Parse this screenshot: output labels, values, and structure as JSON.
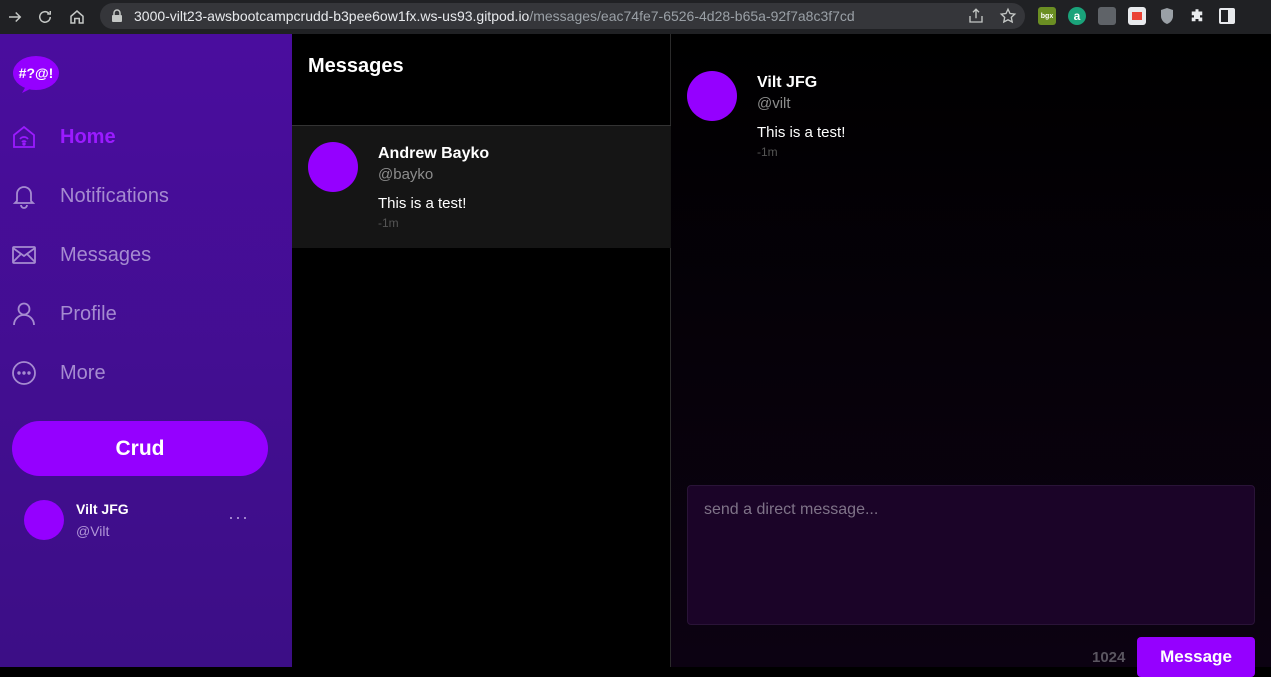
{
  "browser": {
    "url_host": "3000-vilt23-awsbootcampcrudd-b3pee6ow1fx.ws-us93.gitpod.io",
    "url_path": "/messages/eac74fe7-6526-4d28-b65a-92f7a8c3f7cd"
  },
  "sidebar": {
    "logo_text": "#?@!",
    "items": [
      {
        "label": "Home",
        "icon": "home-icon",
        "active": true
      },
      {
        "label": "Notifications",
        "icon": "bell-icon",
        "active": false
      },
      {
        "label": "Messages",
        "icon": "envelope-icon",
        "active": false
      },
      {
        "label": "Profile",
        "icon": "person-icon",
        "active": false
      },
      {
        "label": "More",
        "icon": "ellipsis-circle-icon",
        "active": false
      }
    ],
    "crud_label": "Crud",
    "user": {
      "name": "Vilt JFG",
      "handle": "@Vilt",
      "more": "···"
    }
  },
  "conversations": {
    "title": "Messages",
    "items": [
      {
        "name": "Andrew Bayko",
        "handle": "@bayko",
        "message": "This is a test!",
        "time": "-1m"
      }
    ]
  },
  "thread": {
    "messages": [
      {
        "name": "Vilt JFG",
        "handle": "@vilt",
        "message": "This is a test!",
        "time": "-1m"
      }
    ],
    "composer_placeholder": "send a direct message...",
    "char_count": "1024",
    "send_label": "Message"
  },
  "colors": {
    "accent": "#9500ff",
    "sidebar_bg": "#4a0d9e",
    "nav_inactive": "#a58bd0"
  }
}
